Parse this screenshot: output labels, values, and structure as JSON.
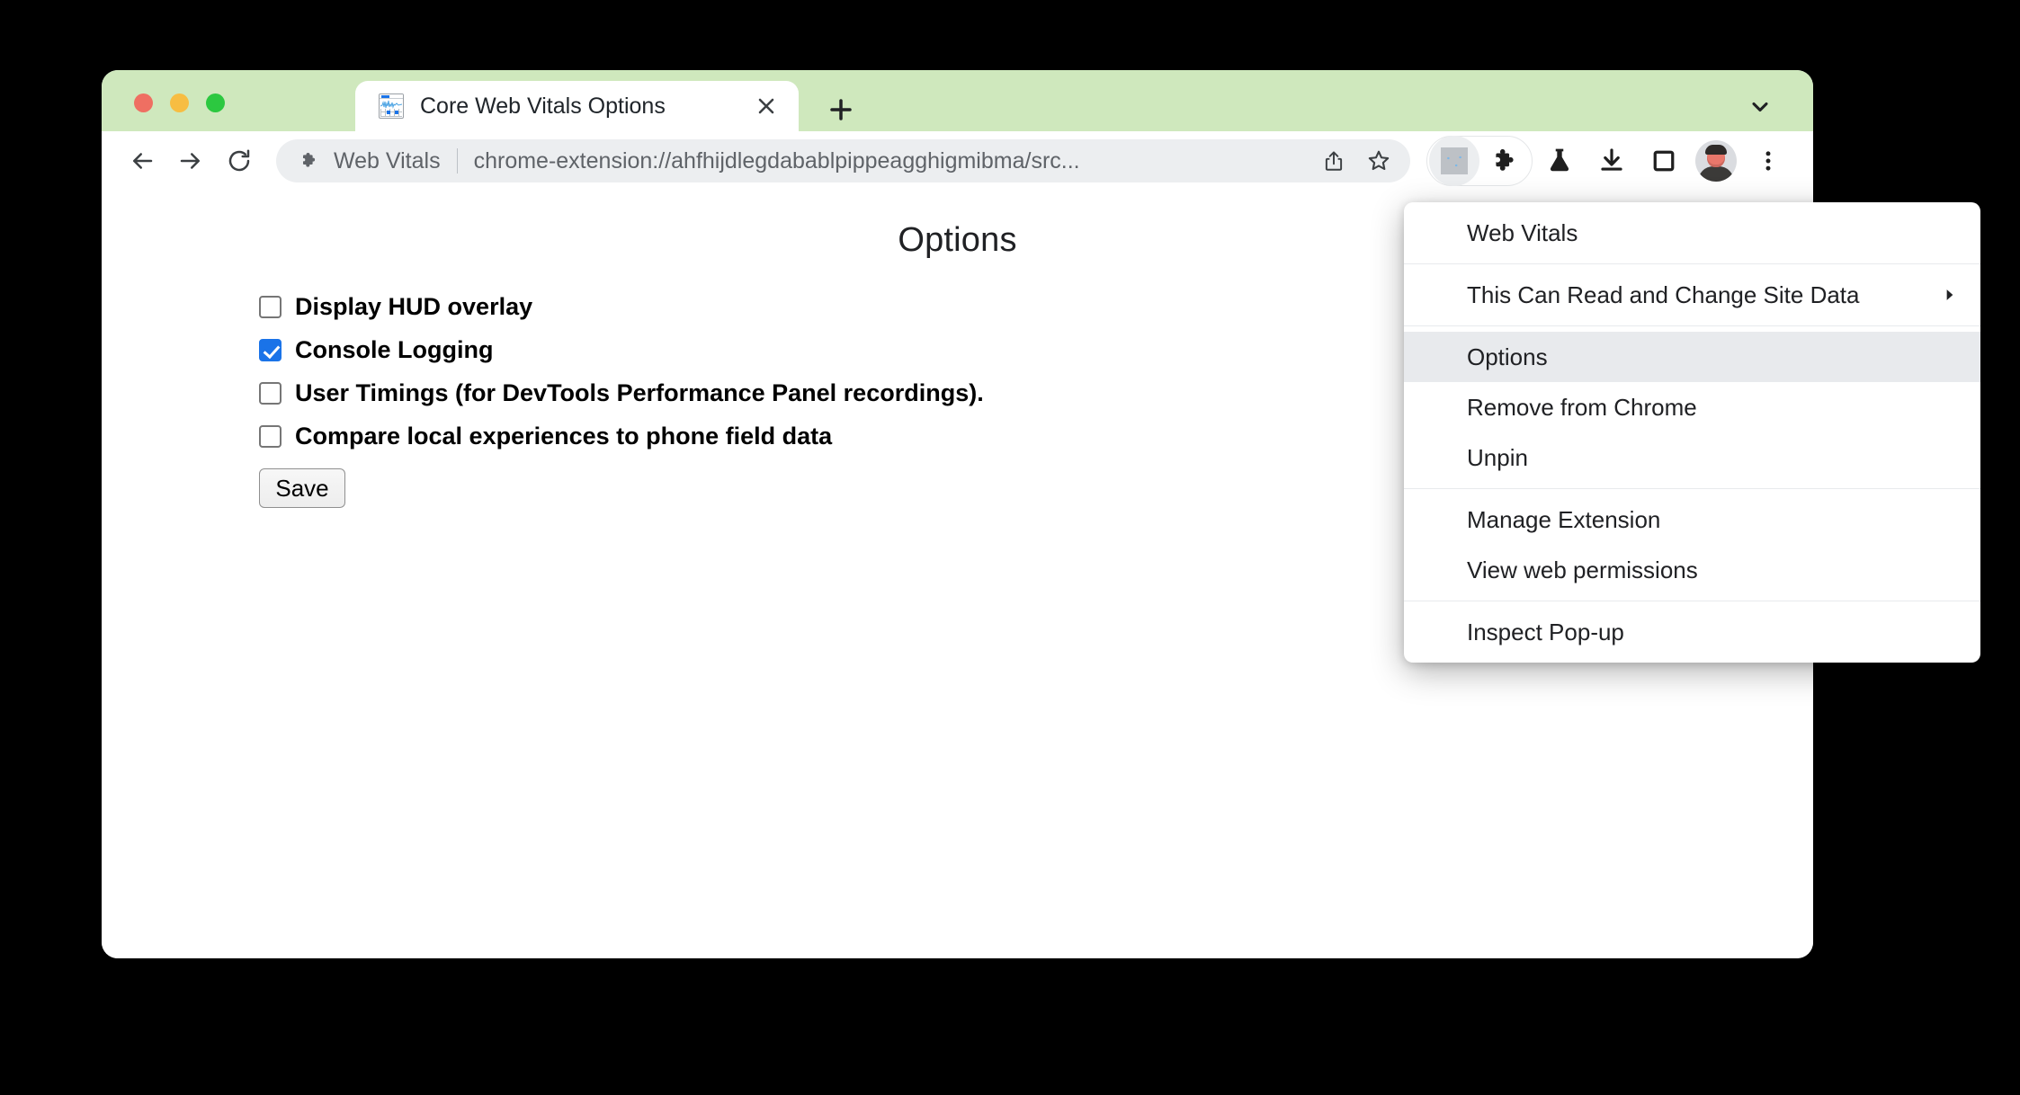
{
  "window": {
    "traffic_lights": [
      "close",
      "minimize",
      "maximize"
    ],
    "tabstrip_color": "#cfe8bd"
  },
  "tab": {
    "title": "Core Web Vitals Options",
    "favicon_name": "web-vitals-chart-icon",
    "close_label": "✕",
    "new_tab_label": "+",
    "tab_list_chevron": "▾"
  },
  "toolbar": {
    "back_label": "←",
    "forward_label": "→",
    "reload_label": "↻",
    "omnibox": {
      "chip_label": "Web Vitals",
      "url": "chrome-extension://ahfhijdlegdabablpippeagghigmibma/src...",
      "extension_icon": "puzzle-piece-icon",
      "share_icon": "share-icon",
      "bookmark_icon": "star-icon"
    },
    "right_icons": [
      {
        "name": "extension-web-vitals-icon",
        "label": ""
      },
      {
        "name": "extensions-puzzle-icon",
        "label": ""
      },
      {
        "name": "experiments-flask-icon",
        "label": ""
      },
      {
        "name": "downloads-icon",
        "label": ""
      },
      {
        "name": "side-panel-icon",
        "label": ""
      },
      {
        "name": "profile-avatar",
        "label": ""
      },
      {
        "name": "chrome-menu-icon",
        "label": "⋮"
      }
    ]
  },
  "page": {
    "title": "Options",
    "options": [
      {
        "label": "Display HUD overlay",
        "checked": false
      },
      {
        "label": "Console Logging",
        "checked": true
      },
      {
        "label": "User Timings (for DevTools Performance Panel recordings).",
        "checked": false
      },
      {
        "label": "Compare local experiences to phone field data",
        "checked": false
      }
    ],
    "save_label": "Save",
    "accent_color": "#1a73e8"
  },
  "extension_menu": {
    "sections": [
      {
        "items": [
          {
            "label": "Web Vitals",
            "highlight": false,
            "submenu": false
          }
        ]
      },
      {
        "items": [
          {
            "label": "This Can Read and Change Site Data",
            "highlight": false,
            "submenu": true
          }
        ]
      },
      {
        "items": [
          {
            "label": "Options",
            "highlight": true,
            "submenu": false
          },
          {
            "label": "Remove from Chrome",
            "highlight": false,
            "submenu": false
          },
          {
            "label": "Unpin",
            "highlight": false,
            "submenu": false
          }
        ]
      },
      {
        "items": [
          {
            "label": "Manage Extension",
            "highlight": false,
            "submenu": false
          },
          {
            "label": "View web permissions",
            "highlight": false,
            "submenu": false
          }
        ]
      },
      {
        "items": [
          {
            "label": "Inspect Pop-up",
            "highlight": false,
            "submenu": false
          }
        ]
      }
    ],
    "submenu_arrow": "▶"
  }
}
